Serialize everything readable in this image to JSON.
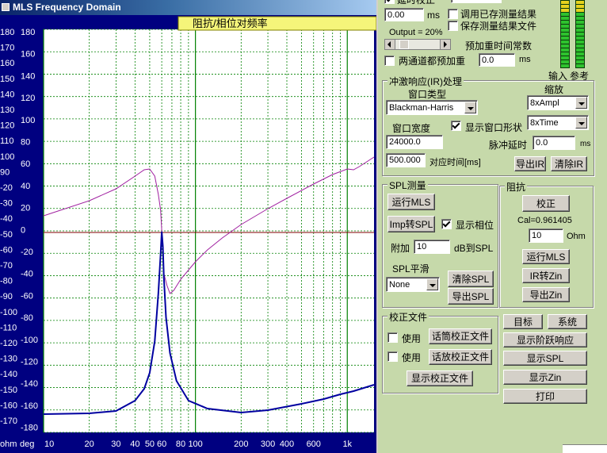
{
  "window_title": "MLS Frequency Domain",
  "plot_title": "阻抗/相位对频率",
  "plot": {
    "left_axis_values": [
      "180",
      "170",
      "160",
      "150",
      "140",
      "130",
      "120",
      "110",
      "100",
      "90",
      "-20",
      "-30",
      "-40",
      "-50",
      "-60",
      "-70",
      "-80",
      "-90",
      "-100",
      "-110",
      "-120",
      "-130",
      "-140",
      "-150",
      "-160",
      "-170"
    ],
    "right_axis_values": [
      "180",
      "160",
      "140",
      "120",
      "100",
      "80",
      "60",
      "40",
      "20",
      "0",
      "-20",
      "-40",
      "-60",
      "-80",
      "-100",
      "-120",
      "-140",
      "-160",
      "-180"
    ],
    "x_ticks": [
      "10",
      "20",
      "30",
      "40",
      "50",
      "60",
      "80",
      "100",
      "200",
      "300",
      "400",
      "600",
      "1k"
    ],
    "unit_left": "ohm",
    "unit_right": "deg",
    "colors": {
      "background": "#ffffff",
      "grid": "#008000",
      "zero_line": "#800000",
      "phase_curve": "#a020a0",
      "impedance_curve": "#0000a0"
    }
  },
  "top_controls": {
    "partial_label": "延时校正",
    "delay_value": "0.00",
    "delay_unit": "ms",
    "chk_load_saved": "调用已存测量结果",
    "chk_save_file": "保存测量结果文件",
    "output_label": "Output = 20%",
    "preemph_label": "预加重时间常数",
    "chk_both_preemph": "两通道都预加重",
    "preemph_value": "0.0",
    "preemph_unit": "ms",
    "meter_labels": [
      "输入",
      "参考"
    ]
  },
  "ir_group": {
    "title": "冲激响应(IR)处理",
    "window_type_label": "窗口类型",
    "window_type_value": "Blackman-Harris",
    "scale_label": "缩放",
    "scale_amp_value": "8xAmpl",
    "scale_time_value": "8xTime",
    "window_width_label": "窗口宽度",
    "chk_show_window": "显示窗口形状",
    "window_width_value": "24000.0",
    "pulse_delay_label": "脉冲延时",
    "pulse_delay_value": "0.0",
    "pulse_delay_unit": "ms",
    "time_value": "500.000",
    "time_label": "对应时间[ms]",
    "btn_export_ir": "导出IR",
    "btn_clear_ir": "清除IR"
  },
  "spl_group": {
    "title": "SPL测量",
    "btn_run_mls": "运行MLS",
    "btn_imp_to_spl": "Imp转SPL",
    "chk_show_phase": "显示相位",
    "add_label": "附加",
    "add_value": "10",
    "add_unit": "dB到SPL",
    "smooth_label": "SPL平滑",
    "smooth_value": "None",
    "btn_clear_spl": "清除SPL",
    "btn_export_spl": "导出SPL"
  },
  "imp_group": {
    "title": "阻抗",
    "btn_calibrate": "校正",
    "cal_text": "Cal=0.961405",
    "ohm_value": "10",
    "ohm_unit": "Ohm",
    "btn_run_mls": "运行MLS",
    "btn_ir_to_zin": "IR转Zin",
    "btn_export_zin": "导出Zin"
  },
  "cal_group": {
    "title": "校正文件",
    "chk_use_1": "使用",
    "btn_mic_cal": "话筒校正文件",
    "chk_use_2": "使用",
    "btn_amp_cal": "话放校正文件",
    "btn_show_cal": "显示校正文件"
  },
  "side_buttons": {
    "target": "目标",
    "system": "系统",
    "show_step": "显示阶跃响应",
    "show_spl": "显示SPL",
    "show_zin": "显示Zin",
    "print": "打印"
  }
}
